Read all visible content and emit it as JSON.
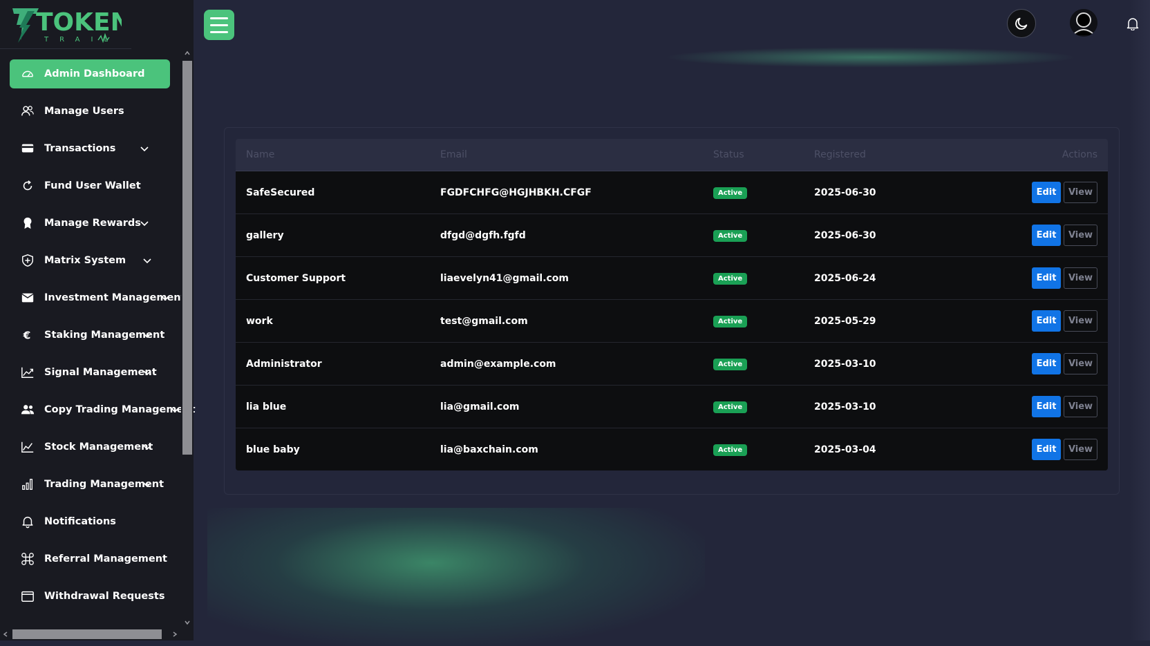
{
  "brand": {
    "logo_main": "TOKEN",
    "logo_sub": "TRAIL"
  },
  "colors": {
    "accent": "#4bc37c",
    "edit_button": "#1174e6",
    "badge_active": "#1aa055",
    "background": "#23263a",
    "sidebar": "#191a21"
  },
  "sidebar": {
    "items": [
      {
        "label": "Admin Dashboard",
        "icon": "gauge-icon",
        "active": true,
        "has_submenu": false
      },
      {
        "label": "Manage Users",
        "icon": "users-icon",
        "active": false,
        "has_submenu": false
      },
      {
        "label": "Transactions",
        "icon": "credit-card-icon",
        "active": false,
        "has_submenu": true
      },
      {
        "label": "Fund User Wallet",
        "icon": "refresh-icon",
        "active": false,
        "has_submenu": false
      },
      {
        "label": "Manage Rewards",
        "icon": "award-icon",
        "active": false,
        "has_submenu": true
      },
      {
        "label": "Matrix System",
        "icon": "shield-icon",
        "active": false,
        "has_submenu": true
      },
      {
        "label": "Investment Management",
        "icon": "envelope-icon",
        "active": false,
        "has_submenu": true
      },
      {
        "label": "Staking Management",
        "icon": "euro-icon",
        "active": false,
        "has_submenu": true
      },
      {
        "label": "Signal Management",
        "icon": "trend-up-icon",
        "active": false,
        "has_submenu": true
      },
      {
        "label": "Copy Trading Management",
        "icon": "user-group-icon",
        "active": false,
        "has_submenu": true
      },
      {
        "label": "Stock Management",
        "icon": "line-chart-icon",
        "active": false,
        "has_submenu": true
      },
      {
        "label": "Trading Management",
        "icon": "bar-chart-icon",
        "active": false,
        "has_submenu": true
      },
      {
        "label": "Notifications",
        "icon": "bell-icon",
        "active": false,
        "has_submenu": false
      },
      {
        "label": "Referral Management",
        "icon": "command-icon",
        "active": false,
        "has_submenu": false
      },
      {
        "label": "Withdrawal Requests",
        "icon": "window-icon",
        "active": false,
        "has_submenu": false
      }
    ]
  },
  "header": {
    "menu_icon": "hamburger-icon",
    "theme_icon": "moon-icon",
    "avatar_icon": "user-avatar-icon",
    "notify_icon": "bell-icon"
  },
  "table": {
    "columns": [
      "Name",
      "Email",
      "Status",
      "Registered",
      "Actions"
    ],
    "rows": [
      {
        "name": "SafeSecured",
        "email": "FGDFCHFG@HGJHBKH.CFGF",
        "status": "Active",
        "registered": "2025-06-30",
        "edit": "Edit",
        "view": "View"
      },
      {
        "name": "gallery",
        "email": "dfgd@dgfh.fgfd",
        "status": "Active",
        "registered": "2025-06-30",
        "edit": "Edit",
        "view": "View"
      },
      {
        "name": "Customer Support",
        "email": "liaevelyn41@gmail.com",
        "status": "Active",
        "registered": "2025-06-24",
        "edit": "Edit",
        "view": "View"
      },
      {
        "name": "work",
        "email": "test@gmail.com",
        "status": "Active",
        "registered": "2025-05-29",
        "edit": "Edit",
        "view": "View"
      },
      {
        "name": "Administrator",
        "email": "admin@example.com",
        "status": "Active",
        "registered": "2025-03-10",
        "edit": "Edit",
        "view": "View"
      },
      {
        "name": "lia blue",
        "email": "lia@gmail.com",
        "status": "Active",
        "registered": "2025-03-10",
        "edit": "Edit",
        "view": "View"
      },
      {
        "name": "blue baby",
        "email": "lia@baxchain.com",
        "status": "Active",
        "registered": "2025-03-04",
        "edit": "Edit",
        "view": "View"
      }
    ]
  }
}
